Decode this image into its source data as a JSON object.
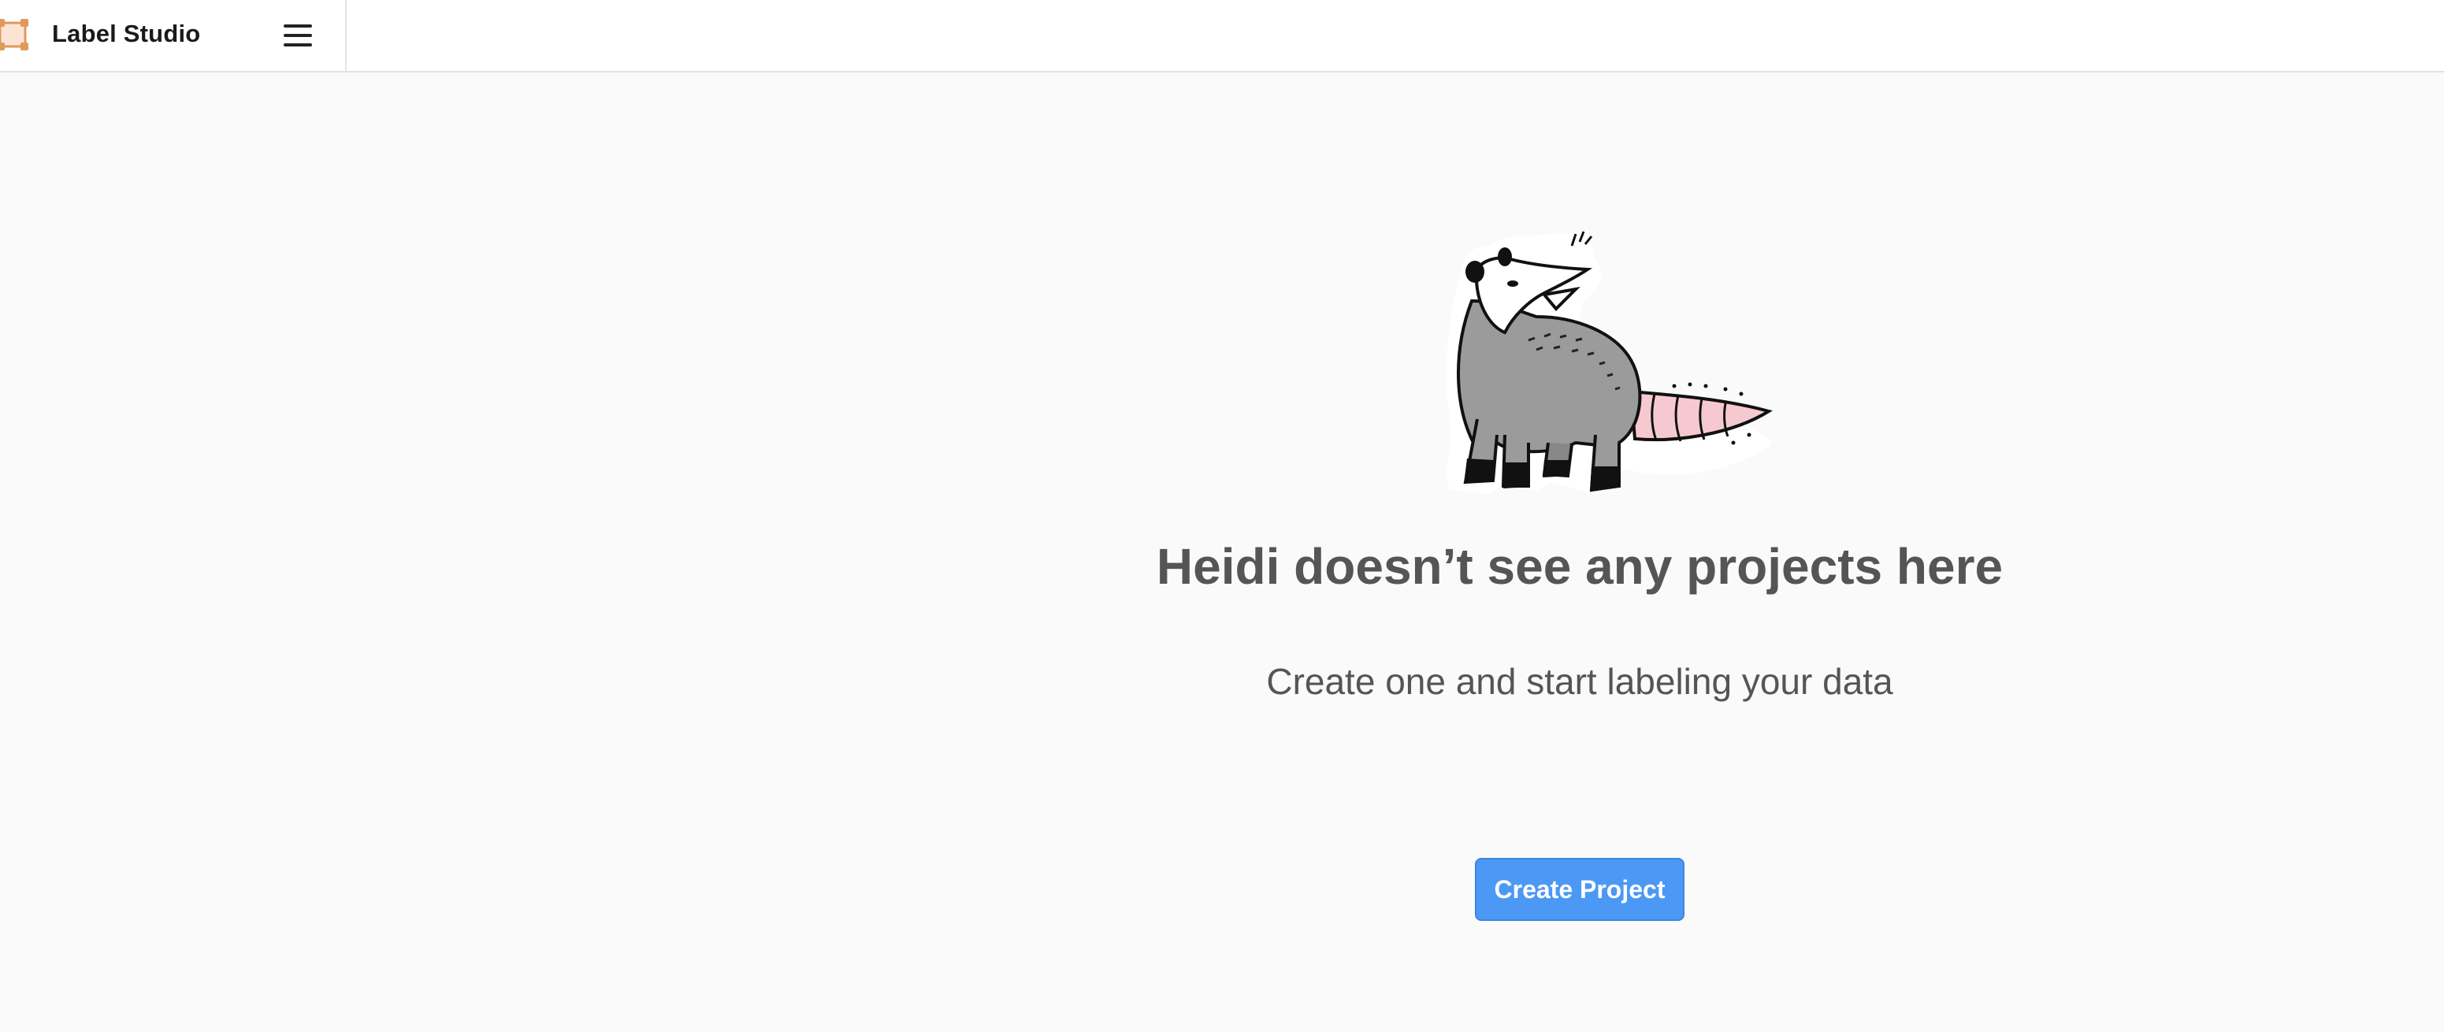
{
  "app": {
    "name": "Label Studio",
    "logo_icon": "label-studio-logo-icon",
    "menu_icon": "hamburger-menu-icon"
  },
  "empty_state": {
    "illustration": "opossum-illustration",
    "title": "Heidi doesn’t see any projects here",
    "subtitle": "Create one and start labeling your data",
    "create_button_label": "Create Project"
  },
  "colors": {
    "accent": "#4c98f5",
    "logo_orange": "#e1995a",
    "background": "#fafafa",
    "text_muted": "#555555"
  }
}
